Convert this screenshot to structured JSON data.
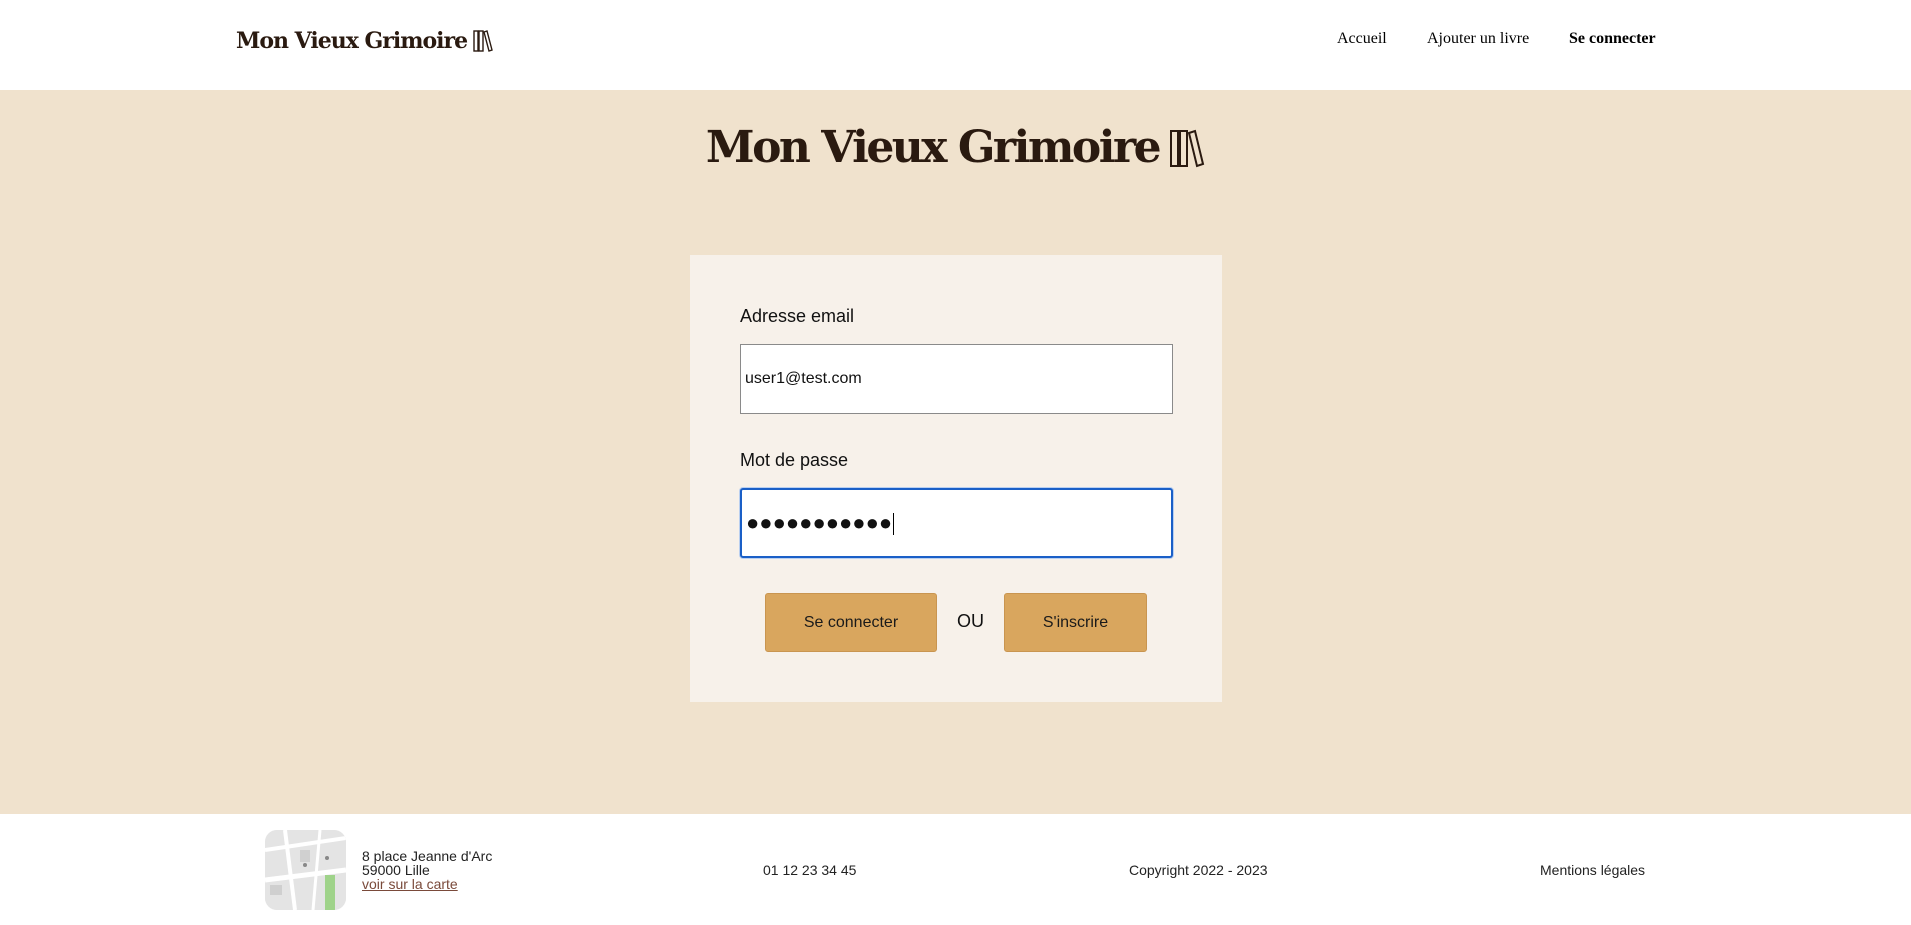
{
  "header": {
    "logo_text": "Mon Vieux Grimoire",
    "logo_icon": "books-icon",
    "nav": {
      "home": "Accueil",
      "add_book": "Ajouter un livre",
      "login": "Se connecter"
    }
  },
  "hero": {
    "title": "Mon Vieux Grimoire",
    "icon": "books-icon"
  },
  "login_form": {
    "email_label": "Adresse email",
    "email_value": "user1@test.com",
    "password_label": "Mot de passe",
    "password_masked": "●●●●●●●●●●●",
    "login_button": "Se connecter",
    "or_text": "OU",
    "signup_button": "S'inscrire"
  },
  "footer": {
    "address_line1": "8 place Jeanne d'Arc",
    "address_line2": "59000 Lille",
    "map_link": "voir sur la carte",
    "phone": "01 12 23 34 45",
    "copyright": "Copyright 2022 - 2023",
    "legal": "Mentions légales"
  },
  "colors": {
    "main_bg": "#f0e2cd",
    "card_bg": "#f7f1ea",
    "button_bg": "#d9a65e",
    "focus_border": "#1a5fc7",
    "brand_text": "#2a1a10"
  }
}
